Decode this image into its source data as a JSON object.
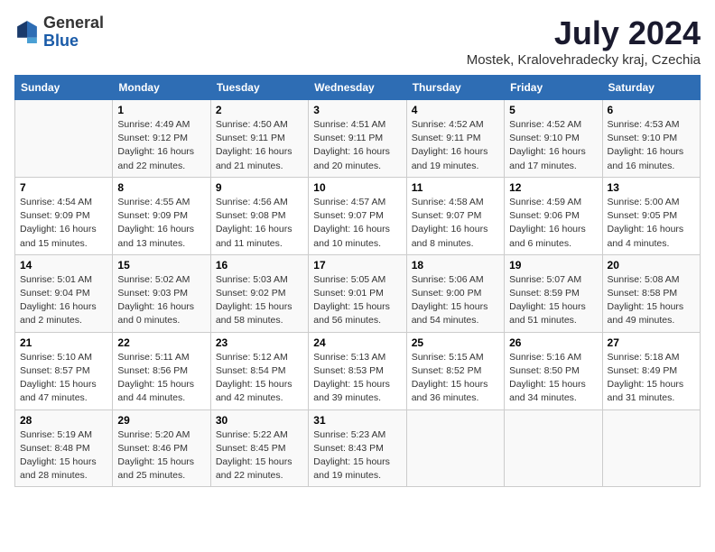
{
  "header": {
    "logo_general": "General",
    "logo_blue": "Blue",
    "title": "July 2024",
    "subtitle": "Mostek, Kralovehradecky kraj, Czechia"
  },
  "days_of_week": [
    "Sunday",
    "Monday",
    "Tuesday",
    "Wednesday",
    "Thursday",
    "Friday",
    "Saturday"
  ],
  "weeks": [
    [
      {
        "day": "",
        "info": ""
      },
      {
        "day": "1",
        "info": "Sunrise: 4:49 AM\nSunset: 9:12 PM\nDaylight: 16 hours\nand 22 minutes."
      },
      {
        "day": "2",
        "info": "Sunrise: 4:50 AM\nSunset: 9:11 PM\nDaylight: 16 hours\nand 21 minutes."
      },
      {
        "day": "3",
        "info": "Sunrise: 4:51 AM\nSunset: 9:11 PM\nDaylight: 16 hours\nand 20 minutes."
      },
      {
        "day": "4",
        "info": "Sunrise: 4:52 AM\nSunset: 9:11 PM\nDaylight: 16 hours\nand 19 minutes."
      },
      {
        "day": "5",
        "info": "Sunrise: 4:52 AM\nSunset: 9:10 PM\nDaylight: 16 hours\nand 17 minutes."
      },
      {
        "day": "6",
        "info": "Sunrise: 4:53 AM\nSunset: 9:10 PM\nDaylight: 16 hours\nand 16 minutes."
      }
    ],
    [
      {
        "day": "7",
        "info": "Sunrise: 4:54 AM\nSunset: 9:09 PM\nDaylight: 16 hours\nand 15 minutes."
      },
      {
        "day": "8",
        "info": "Sunrise: 4:55 AM\nSunset: 9:09 PM\nDaylight: 16 hours\nand 13 minutes."
      },
      {
        "day": "9",
        "info": "Sunrise: 4:56 AM\nSunset: 9:08 PM\nDaylight: 16 hours\nand 11 minutes."
      },
      {
        "day": "10",
        "info": "Sunrise: 4:57 AM\nSunset: 9:07 PM\nDaylight: 16 hours\nand 10 minutes."
      },
      {
        "day": "11",
        "info": "Sunrise: 4:58 AM\nSunset: 9:07 PM\nDaylight: 16 hours\nand 8 minutes."
      },
      {
        "day": "12",
        "info": "Sunrise: 4:59 AM\nSunset: 9:06 PM\nDaylight: 16 hours\nand 6 minutes."
      },
      {
        "day": "13",
        "info": "Sunrise: 5:00 AM\nSunset: 9:05 PM\nDaylight: 16 hours\nand 4 minutes."
      }
    ],
    [
      {
        "day": "14",
        "info": "Sunrise: 5:01 AM\nSunset: 9:04 PM\nDaylight: 16 hours\nand 2 minutes."
      },
      {
        "day": "15",
        "info": "Sunrise: 5:02 AM\nSunset: 9:03 PM\nDaylight: 16 hours\nand 0 minutes."
      },
      {
        "day": "16",
        "info": "Sunrise: 5:03 AM\nSunset: 9:02 PM\nDaylight: 15 hours\nand 58 minutes."
      },
      {
        "day": "17",
        "info": "Sunrise: 5:05 AM\nSunset: 9:01 PM\nDaylight: 15 hours\nand 56 minutes."
      },
      {
        "day": "18",
        "info": "Sunrise: 5:06 AM\nSunset: 9:00 PM\nDaylight: 15 hours\nand 54 minutes."
      },
      {
        "day": "19",
        "info": "Sunrise: 5:07 AM\nSunset: 8:59 PM\nDaylight: 15 hours\nand 51 minutes."
      },
      {
        "day": "20",
        "info": "Sunrise: 5:08 AM\nSunset: 8:58 PM\nDaylight: 15 hours\nand 49 minutes."
      }
    ],
    [
      {
        "day": "21",
        "info": "Sunrise: 5:10 AM\nSunset: 8:57 PM\nDaylight: 15 hours\nand 47 minutes."
      },
      {
        "day": "22",
        "info": "Sunrise: 5:11 AM\nSunset: 8:56 PM\nDaylight: 15 hours\nand 44 minutes."
      },
      {
        "day": "23",
        "info": "Sunrise: 5:12 AM\nSunset: 8:54 PM\nDaylight: 15 hours\nand 42 minutes."
      },
      {
        "day": "24",
        "info": "Sunrise: 5:13 AM\nSunset: 8:53 PM\nDaylight: 15 hours\nand 39 minutes."
      },
      {
        "day": "25",
        "info": "Sunrise: 5:15 AM\nSunset: 8:52 PM\nDaylight: 15 hours\nand 36 minutes."
      },
      {
        "day": "26",
        "info": "Sunrise: 5:16 AM\nSunset: 8:50 PM\nDaylight: 15 hours\nand 34 minutes."
      },
      {
        "day": "27",
        "info": "Sunrise: 5:18 AM\nSunset: 8:49 PM\nDaylight: 15 hours\nand 31 minutes."
      }
    ],
    [
      {
        "day": "28",
        "info": "Sunrise: 5:19 AM\nSunset: 8:48 PM\nDaylight: 15 hours\nand 28 minutes."
      },
      {
        "day": "29",
        "info": "Sunrise: 5:20 AM\nSunset: 8:46 PM\nDaylight: 15 hours\nand 25 minutes."
      },
      {
        "day": "30",
        "info": "Sunrise: 5:22 AM\nSunset: 8:45 PM\nDaylight: 15 hours\nand 22 minutes."
      },
      {
        "day": "31",
        "info": "Sunrise: 5:23 AM\nSunset: 8:43 PM\nDaylight: 15 hours\nand 19 minutes."
      },
      {
        "day": "",
        "info": ""
      },
      {
        "day": "",
        "info": ""
      },
      {
        "day": "",
        "info": ""
      }
    ]
  ]
}
